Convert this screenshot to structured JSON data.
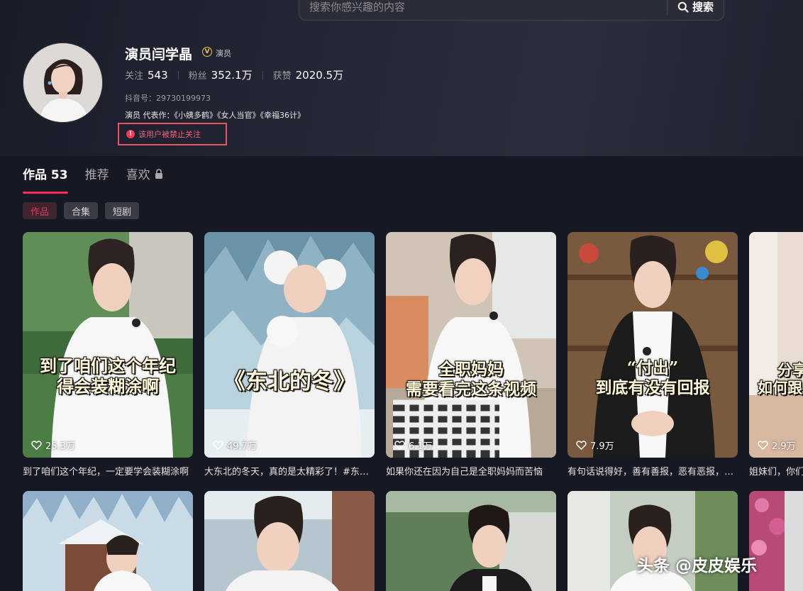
{
  "search": {
    "placeholder": "搜索你感兴趣的内容",
    "button_label": "搜索"
  },
  "profile": {
    "name": "演员闫学晶",
    "verify_label": "演员",
    "verify_badge": "V",
    "stats": [
      {
        "label": "关注",
        "value": "543"
      },
      {
        "label": "粉丝",
        "value": "352.1万"
      },
      {
        "label": "获赞",
        "value": "2020.5万"
      }
    ],
    "douyin_id": "抖音号：29730199973",
    "bio": "演员 代表作：《小姨多鹤》《女人当官》《幸福36计》",
    "warning": "该用户被禁止关注"
  },
  "tabs": [
    {
      "label": "作品 53",
      "active": true
    },
    {
      "label": "推荐",
      "active": false
    },
    {
      "label": "喜欢",
      "active": false,
      "locked": true
    }
  ],
  "chips": [
    {
      "label": "作品",
      "active": true
    },
    {
      "label": "合集",
      "active": false
    },
    {
      "label": "短剧",
      "active": false
    }
  ],
  "videos": [
    {
      "overlay": [
        "到了咱们这个年纪",
        "得会装糊涂啊"
      ],
      "likes": "25.3万",
      "caption": "到了咱们这个年纪，一定要学会装糊涂啊"
    },
    {
      "overlay": [
        "《东北的冬》"
      ],
      "likes": "49.7万",
      "caption": "大东北的冬天，真的是太精彩了！#东北的冬天"
    },
    {
      "overlay": [
        "全职妈妈",
        "需要看完这条视频"
      ],
      "likes": "6.1万",
      "caption": "如果你还在因为自己是全职妈妈而苦恼"
    },
    {
      "overlay": [
        "“付出”",
        "到底有没有回报"
      ],
      "likes": "7.9万",
      "caption": "有句话说得好，善有善报，恶有恶报，不是不报"
    },
    {
      "overlay": [
        "分享",
        "如何跟"
      ],
      "likes": "2.9万",
      "caption": "姐妹们，你们"
    },
    {
      "overlay": [],
      "likes": "",
      "caption": ""
    },
    {
      "overlay": [],
      "likes": "",
      "caption": ""
    },
    {
      "overlay": [],
      "likes": "",
      "caption": ""
    },
    {
      "overlay": [],
      "likes": "",
      "caption": ""
    },
    {
      "overlay": [],
      "likes": "",
      "caption": ""
    }
  ],
  "watermark": "头条 @皮皮娱乐",
  "colors": {
    "accent": "#fe2c55",
    "background": "#161823",
    "warning": "#e85562"
  }
}
